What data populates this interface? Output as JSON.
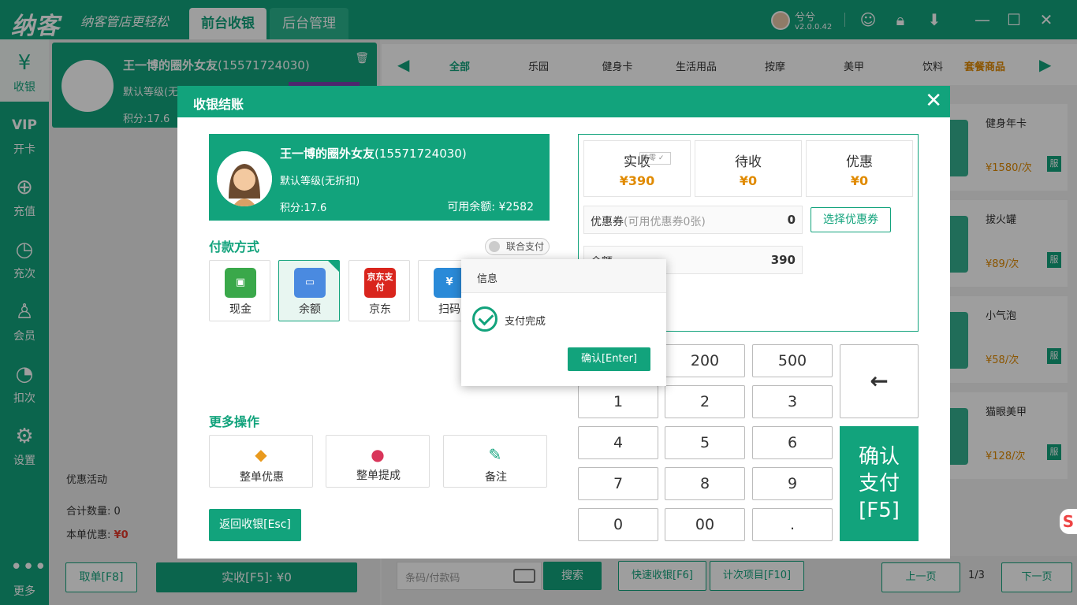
{
  "header": {
    "logo": "纳客",
    "slogan": "纳客管店更轻松",
    "tabs": [
      "前台收银",
      "后台管理"
    ],
    "user_name": "兮兮",
    "version": "v2.0.0.42"
  },
  "sidebar": {
    "items": [
      {
        "label": "收银",
        "icon": "cashier-icon"
      },
      {
        "label": "开卡",
        "icon": "vip-card-icon"
      },
      {
        "label": "充值",
        "icon": "recharge-icon"
      },
      {
        "label": "充次",
        "icon": "recharge-times-icon"
      },
      {
        "label": "会员",
        "icon": "member-icon"
      },
      {
        "label": "扣次",
        "icon": "deduct-icon"
      },
      {
        "label": "设置",
        "icon": "settings-icon"
      },
      {
        "label": "更多",
        "icon": "more-icon"
      }
    ]
  },
  "cart": {
    "member_name": "王一博的圈外女友",
    "member_phone": "(15571724030)",
    "member_level": "默认等级(无折扣)",
    "member_points": "积分:17.6",
    "promo_label": "优惠活动",
    "total_qty": "合计数量: 0",
    "discount_label": "本单优惠:",
    "discount_value": "¥0",
    "cancel_btn": "取单[F8]",
    "pay_btn": "实收[F5]: ¥0"
  },
  "categories": [
    "全部",
    "乐园",
    "健身卡",
    "生活用品",
    "按摩",
    "美甲",
    "饮料",
    "套餐商品"
  ],
  "products": [
    {
      "name": "健身年卡",
      "price": "¥1580/次",
      "tag": "服"
    },
    {
      "name": "拔火罐",
      "price": "¥89/次",
      "tag": "服"
    },
    {
      "name": "小气泡",
      "price": "¥58/次",
      "tag": "服"
    },
    {
      "name": "猫眼美甲",
      "price": "¥128/次",
      "tag": "服"
    }
  ],
  "bottom": {
    "search_placeholder": "条码/付款码",
    "search_btn": "搜索",
    "quick_btn": "快速收银[F6]",
    "times_btn": "计次项目[F10]",
    "prev_btn": "上一页",
    "page": "1/3",
    "next_btn": "下一页"
  },
  "dialog": {
    "title": "收银结账",
    "member_name": "王一博的圈外女友",
    "member_phone": "(15571724030)",
    "member_level": "默认等级(无折扣)",
    "member_points": "积分:17.6",
    "member_balance": "可用余额: ¥2582",
    "pay_section": "付款方式",
    "joint_pay": "联合支付",
    "pay_methods": [
      {
        "label": "现金",
        "icon": "cash-icon",
        "color": "#3aa84a"
      },
      {
        "label": "余额",
        "icon": "balance-icon",
        "color": "#4a8ae0"
      },
      {
        "label": "京东",
        "icon": "jd-pay-icon",
        "color": "#d9251d",
        "icon_text": "京东支付"
      },
      {
        "label": "扫码",
        "icon": "scan-icon",
        "color": "#2a8ad8"
      }
    ],
    "more_section": "更多操作",
    "ops": [
      {
        "label": "整单优惠",
        "icon": "tag-icon",
        "color": "#e99a1e"
      },
      {
        "label": "整单提成",
        "icon": "money-bag-icon",
        "color": "#d9355a"
      },
      {
        "label": "备注",
        "icon": "note-icon",
        "color": "#12a37c"
      }
    ],
    "back_btn": "返回收银[Esc]",
    "summary": [
      {
        "label": "实收",
        "value": "¥390",
        "badge": "抹零"
      },
      {
        "label": "待收",
        "value": "¥0"
      },
      {
        "label": "优惠",
        "value": "¥0"
      }
    ],
    "coupon_label": "优惠券",
    "coupon_hint": "(可用优惠券0张)",
    "coupon_value": "0",
    "coupon_btn": "选择优惠券",
    "balance_label": "余额",
    "balance_value": "390",
    "keys": [
      "200",
      "500",
      "1",
      "2",
      "3",
      "4",
      "5",
      "6",
      "7",
      "8",
      "9",
      "0",
      "00",
      "."
    ],
    "backspace": "←",
    "confirm_line1": "确认",
    "confirm_line2": "支付",
    "confirm_line3": "[F5]"
  },
  "info": {
    "title": "信息",
    "message": "支付完成",
    "ok_btn": "确认[Enter]"
  },
  "colors": {
    "primary": "#12a37c",
    "accent": "#e08a00",
    "danger": "#e23b2d"
  }
}
